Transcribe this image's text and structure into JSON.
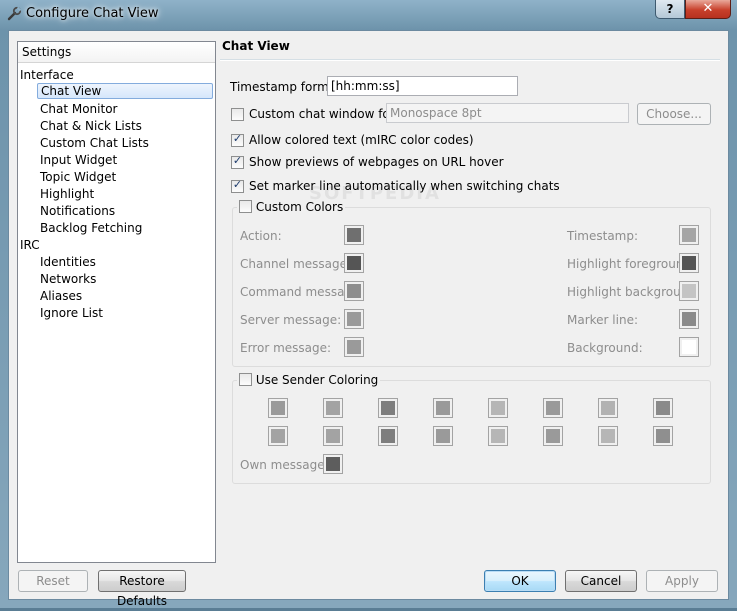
{
  "window": {
    "title": "Configure Chat View",
    "help_label": "?",
    "close_label": "✕"
  },
  "tree": {
    "header": "Settings",
    "groups": [
      {
        "label": "Interface",
        "items": [
          "Chat View",
          "Chat Monitor",
          "Chat & Nick Lists",
          "Custom Chat Lists",
          "Input Widget",
          "Topic Widget",
          "Highlight",
          "Notifications",
          "Backlog Fetching"
        ]
      },
      {
        "label": "IRC",
        "items": [
          "Identities",
          "Networks",
          "Aliases",
          "Ignore List"
        ]
      }
    ],
    "selected": "Chat View"
  },
  "page": {
    "title": "Chat View",
    "timestamp_label": "Timestamp format:",
    "timestamp_value": "[hh:mm:ss]",
    "custom_font_label": "Custom chat window font:",
    "custom_font_checked": false,
    "font_value": "Monospace 8pt",
    "choose_label": "Choose...",
    "colored_text_label": "Allow colored text (mIRC color codes)",
    "colored_text_checked": true,
    "previews_label": "Show previews of webpages on URL hover",
    "previews_checked": true,
    "marker_label": "Set marker line automatically when switching chats",
    "marker_checked": true
  },
  "custom_colors": {
    "title": "Custom Colors",
    "checked": false,
    "left": [
      {
        "label": "Action:",
        "color": "#6f6f6f"
      },
      {
        "label": "Channel message:",
        "color": "#555555"
      },
      {
        "label": "Command message:",
        "color": "#8e8e8e"
      },
      {
        "label": "Server message:",
        "color": "#9a9a9a"
      },
      {
        "label": "Error message:",
        "color": "#9a9a9a"
      }
    ],
    "right": [
      {
        "label": "Timestamp:",
        "color": "#a5a5a5"
      },
      {
        "label": "Highlight foreground:",
        "color": "#555555"
      },
      {
        "label": "Highlight background:",
        "color": "#c4c4c4"
      },
      {
        "label": "Marker line:",
        "color": "#8a8a8a"
      },
      {
        "label": "Background:",
        "color": "#ffffff"
      }
    ]
  },
  "sender_coloring": {
    "title": "Use Sender Coloring",
    "checked": false,
    "row1": [
      "#9a9a9a",
      "#a3a3a3",
      "#7e7e7e",
      "#9a9a9a",
      "#b6b6b6",
      "#9a9a9a",
      "#b2b2b2",
      "#8a8a8a"
    ],
    "row2": [
      "#a3a3a3",
      "#a3a3a3",
      "#7e7e7e",
      "#9a9a9a",
      "#b6b6b6",
      "#9a9a9a",
      "#b6b6b6",
      "#8f8f8f"
    ],
    "own_label": "Own messages:",
    "own_color": "#5d5d5d"
  },
  "buttons": {
    "reset": "Reset",
    "restore_defaults": "Restore Defaults",
    "ok": "OK",
    "cancel": "Cancel",
    "apply": "Apply"
  },
  "watermark": "SOFTPEDIA"
}
